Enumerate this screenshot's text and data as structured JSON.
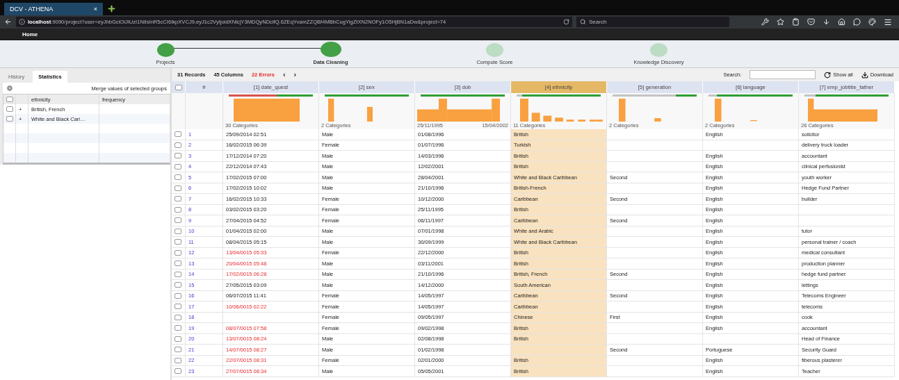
{
  "browser": {
    "tab": {
      "title": "DCV - ATHENA",
      "close": "×"
    },
    "url": "**localhost**:9090/project?user=eyJhbGciOiJIUzI1NiIsInR5cCI6IkpXVCJ9.eyJ1c2VyIjoidXNlcjY3MDQyNDcifQ.6ZEqYvamZZQBf4MBbCugYigZtXN2NOFy1O5HjBN1aDw&project=74",
    "search": {
      "placeholder": "Search"
    }
  },
  "nav": {
    "items": [
      {
        "label": "Home"
      }
    ]
  },
  "stepper": [
    {
      "label": "Projects",
      "completed": true,
      "selected": false
    },
    {
      "label": "Data Cleaning",
      "completed": true,
      "selected": true
    },
    {
      "label": "Compute Score",
      "completed": false,
      "selected": false
    },
    {
      "label": "Knowledge Discovery",
      "completed": false,
      "selected": false
    }
  ],
  "left_panel": {
    "tabs": [
      {
        "label": "History",
        "selected": false
      },
      {
        "label": "Statistics",
        "selected": true
      }
    ],
    "merge_label": "Merge values of selected groups",
    "select_all_checked": false,
    "columns": [
      "ethnicity",
      "frequency"
    ],
    "groups": [
      {
        "expander": "+",
        "label": "British, French",
        "checked": false
      },
      {
        "expander": "+",
        "label": "White and Black Cari…",
        "checked": false
      }
    ]
  },
  "toolbar": {
    "records": "31 Records",
    "columns": "45 Columns",
    "errors": "22 Errors",
    "prev": "‹",
    "next": "›",
    "search_label": "Search:",
    "show_all": "Show all",
    "download": "Download"
  },
  "table": {
    "index_header": "#",
    "select_all_checked": false,
    "columns": [
      {
        "title": "[1] date_quest",
        "selected": false,
        "errors": true,
        "quality": {
          "level": 0.43
        },
        "footer_left": "30 Categories"
      },
      {
        "title": "[2] sex",
        "selected": false,
        "quality": {
          "level": 1
        },
        "footer_left": "2 Categories"
      },
      {
        "title": "[3] dob",
        "selected": false,
        "quality": {
          "level": 1
        },
        "footer_left": "25/11/1995",
        "footer_right": "15/04/2002"
      },
      {
        "title": "[4] ethnicity",
        "selected": true,
        "errors": false,
        "quality": {
          "level": 0.93
        },
        "footer_left": "11 Categories"
      },
      {
        "title": "[5] generation",
        "selected": false,
        "errors": false,
        "quality": {
          "level": 0.25
        },
        "footer_left": "2 Categories"
      },
      {
        "title": "[6] language",
        "selected": false,
        "errors": false,
        "quality": {
          "level": 0.9
        },
        "footer_left": "2 Categories"
      },
      {
        "title": "[7] emp_jobtitle_father",
        "selected": false,
        "errors": false,
        "quality": {
          "level": 0.87
        },
        "footer_left": "26 Categories"
      }
    ],
    "rows": [
      {
        "index": "1",
        "checked": false,
        "error": false,
        "cells": [
          "25/09/2014 02:51",
          "Male",
          "01/08/1996",
          "British",
          null,
          "English",
          "solicitor"
        ]
      },
      {
        "index": "2",
        "checked": false,
        "error": false,
        "cells": [
          "16/02/2015 06:39",
          "Female",
          "01/07/1996",
          "Turkish",
          null,
          null,
          "delivery truck loader"
        ]
      },
      {
        "index": "3",
        "checked": false,
        "error": false,
        "cells": [
          "17/12/2014 07:20",
          "Male",
          "14/03/1996",
          "British",
          null,
          "English",
          "accountant"
        ]
      },
      {
        "index": "4",
        "checked": false,
        "error": false,
        "cells": [
          "22/12/2014 07:43",
          "Male",
          "12/02/2001",
          "British",
          null,
          "English",
          "clinical perfusionist"
        ]
      },
      {
        "index": "5",
        "checked": false,
        "error": false,
        "cells": [
          "17/02/2015 07:00",
          "Male",
          "28/04/2001",
          "White and Black Caribbean",
          "Second",
          "English",
          "youth worker"
        ]
      },
      {
        "index": "6",
        "checked": false,
        "error": false,
        "cells": [
          "17/02/2015 10:02",
          "Male",
          "21/10/1996",
          "British-French",
          null,
          "English",
          "Hedge Fund Partner"
        ]
      },
      {
        "index": "7",
        "checked": false,
        "error": false,
        "cells": [
          "16/02/2015 10:33",
          "Female",
          "10/12/2000",
          "Caribbean",
          "Second",
          "English",
          "builder"
        ]
      },
      {
        "index": "8",
        "checked": false,
        "error": false,
        "cells": [
          "03/02/2015 03:20",
          "Female",
          "25/11/1995",
          "British",
          null,
          "English",
          null
        ]
      },
      {
        "index": "9",
        "checked": false,
        "error": false,
        "cells": [
          "27/04/2015 04:52",
          "Female",
          "06/11/1997",
          "Caribbean",
          "Second",
          "English",
          null
        ]
      },
      {
        "index": "10",
        "checked": false,
        "error": false,
        "cells": [
          "01/04/2015 02:00",
          "Male",
          "07/01/1998",
          "White and Arabic",
          null,
          "English",
          "tutor"
        ]
      },
      {
        "index": "11",
        "checked": false,
        "error": false,
        "cells": [
          "08/04/2015 05:15",
          "Male",
          "30/09/1999",
          "White and Black Caribbean",
          null,
          "English",
          "personal trainer / coach"
        ]
      },
      {
        "index": "12",
        "checked": false,
        "error": true,
        "cells": [
          "13/04/0015 05:33",
          "Female",
          "22/12/2000",
          "British",
          null,
          "English",
          "medical consultant"
        ]
      },
      {
        "index": "13",
        "checked": false,
        "error": true,
        "cells": [
          "20/04/0015 05:48",
          "Male",
          "03/11/2001",
          "British",
          null,
          "English",
          "production planner"
        ]
      },
      {
        "index": "14",
        "checked": false,
        "error": true,
        "cells": [
          "17/02/0015 06:28",
          "Male",
          "21/10/1996",
          "British, French",
          "Second",
          "English",
          "hedge fund partner"
        ]
      },
      {
        "index": "15",
        "checked": false,
        "error": false,
        "cells": [
          "27/05/2015 03:09",
          "Male",
          "14/12/2000",
          "South American",
          null,
          "English",
          "lettings"
        ]
      },
      {
        "index": "16",
        "checked": false,
        "error": false,
        "cells": [
          "06/07/2015 11:41",
          "Female",
          "14/05/1997",
          "Caribbean",
          "Second",
          "English",
          "Telecoms Engineer"
        ]
      },
      {
        "index": "17",
        "checked": false,
        "error": true,
        "cells": [
          "10/06/0015 02:22",
          "Female",
          "14/05/1997",
          "Caribbean",
          null,
          "English",
          "telecoms"
        ]
      },
      {
        "index": "18",
        "checked": false,
        "error": false,
        "cells": [
          null,
          "Female",
          "09/05/1997",
          "Chinese",
          "First",
          "English",
          "cook"
        ]
      },
      {
        "index": "19",
        "checked": false,
        "error": true,
        "cells": [
          "08/07/0015 07:58",
          "Female",
          "09/02/1998",
          "British",
          null,
          "English",
          "accountant"
        ]
      },
      {
        "index": "20",
        "checked": false,
        "error": true,
        "cells": [
          "13/07/0015 08:24",
          "Male",
          "02/08/1998",
          "British",
          null,
          null,
          "Head of Finance"
        ]
      },
      {
        "index": "21",
        "checked": false,
        "error": true,
        "cells": [
          "14/07/0015 08:27",
          "Male",
          "01/02/1998",
          null,
          "Second",
          "Portuguese",
          "Security Guard"
        ]
      },
      {
        "index": "22",
        "checked": false,
        "error": true,
        "cells": [
          "22/07/0015 08:31",
          "Female",
          "02/01/2000",
          "British",
          null,
          "English",
          "fiberous plasterer"
        ]
      },
      {
        "index": "23",
        "checked": false,
        "error": true,
        "cells": [
          "27/07/0015 08:34",
          "Male",
          "05/05/2001",
          "British",
          null,
          "English",
          "Teacher"
        ]
      }
    ]
  }
}
